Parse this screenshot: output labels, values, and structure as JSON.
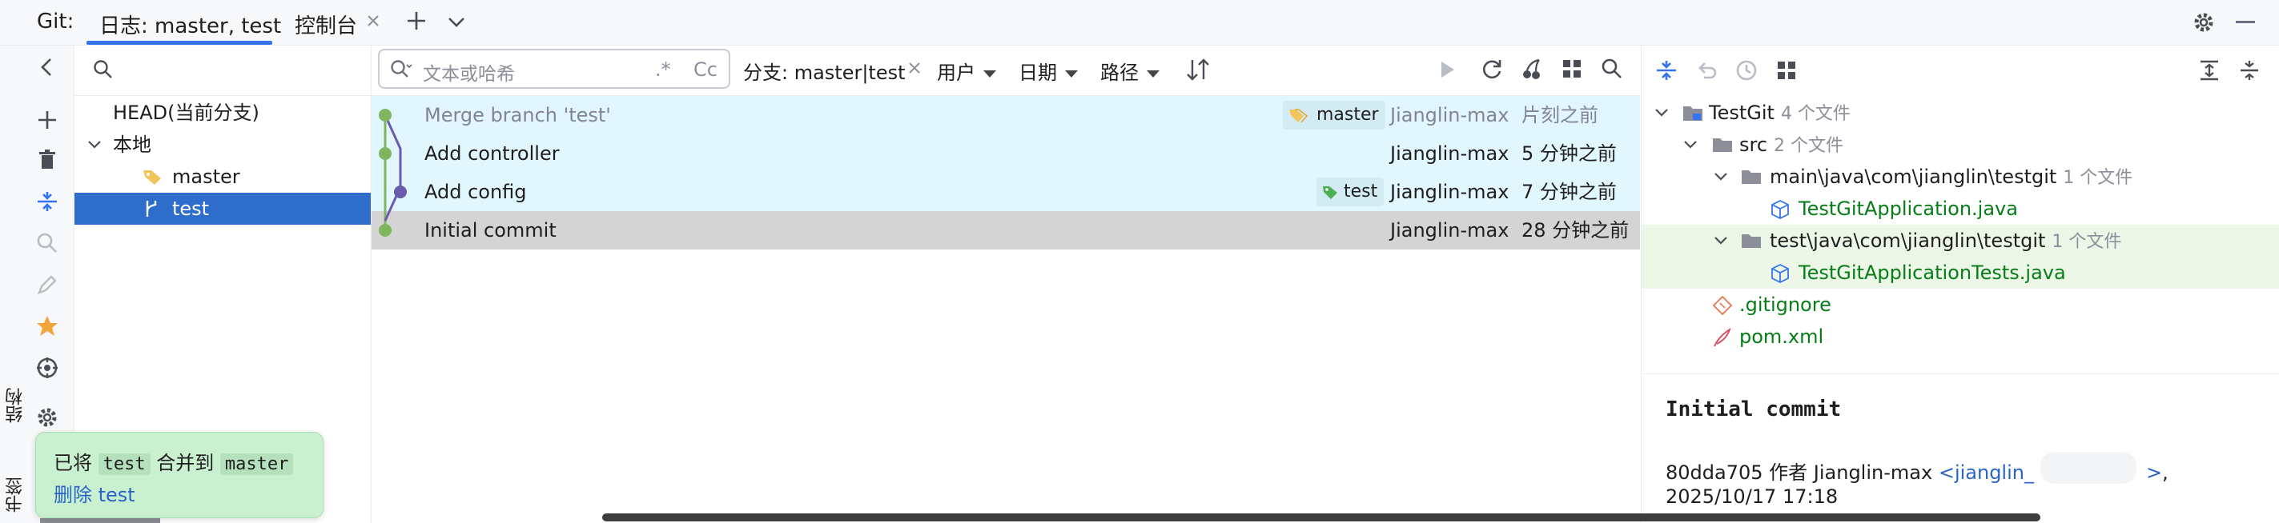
{
  "tabs": {
    "app_label": "Git:",
    "log_tab": "日志: master, test",
    "console_tab": "控制台"
  },
  "side_tool_windows": {
    "structure": "结构",
    "bookmarks": "书签"
  },
  "branches": {
    "head": "HEAD(当前分支)",
    "local_group": "本地",
    "items": [
      "master",
      "test"
    ],
    "selected": "test"
  },
  "log_toolbar": {
    "search_placeholder": "文本或哈希",
    "regex": ".*",
    "case": "Cc",
    "branch_filter": "分支: master|test",
    "user_filter": "用户",
    "date_filter": "日期",
    "path_filter": "路径"
  },
  "commits": [
    {
      "message": "Merge branch 'test'",
      "ref": "master",
      "author": "Jianglin-max",
      "date": "片刻之前"
    },
    {
      "message": "Add controller",
      "ref": "",
      "author": "Jianglin-max",
      "date": "5 分钟之前"
    },
    {
      "message": "Add config",
      "ref": "test",
      "author": "Jianglin-max",
      "date": "7 分钟之前"
    },
    {
      "message": "Initial commit",
      "ref": "",
      "author": "Jianglin-max",
      "date": "28 分钟之前"
    }
  ],
  "changes_tree": {
    "root": {
      "name": "TestGit",
      "count": "4 个文件"
    },
    "src": {
      "name": "src",
      "count": "2 个文件"
    },
    "main_dir": {
      "name": "main\\java\\com\\jianglin\\testgit",
      "count": "1 个文件"
    },
    "main_file": "TestGitApplication.java",
    "test_dir": {
      "name": "test\\java\\com\\jianglin\\testgit",
      "count": "1 个文件"
    },
    "test_file": "TestGitApplicationTests.java",
    "gitignore": ".gitignore",
    "pom": "pom.xml"
  },
  "commit_details": {
    "subject": "Initial commit",
    "hash_author": "80dda705 作者 Jianglin-max",
    "email": "<jianglin_",
    "email_end": ">",
    "comma": ",",
    "date": "2025/10/17 17:18"
  },
  "notification": {
    "prefix": "已将",
    "branch": "test",
    "middle": "合并到",
    "target": "master",
    "action": "删除 test"
  },
  "colors": {
    "accent": "#3574f0",
    "selected_branch": "#2f6dcc",
    "highlight_row": "#e2f6fd",
    "graph_green": "#7fb55f",
    "graph_purple": "#6b5bad",
    "added_file": "#067d17"
  }
}
